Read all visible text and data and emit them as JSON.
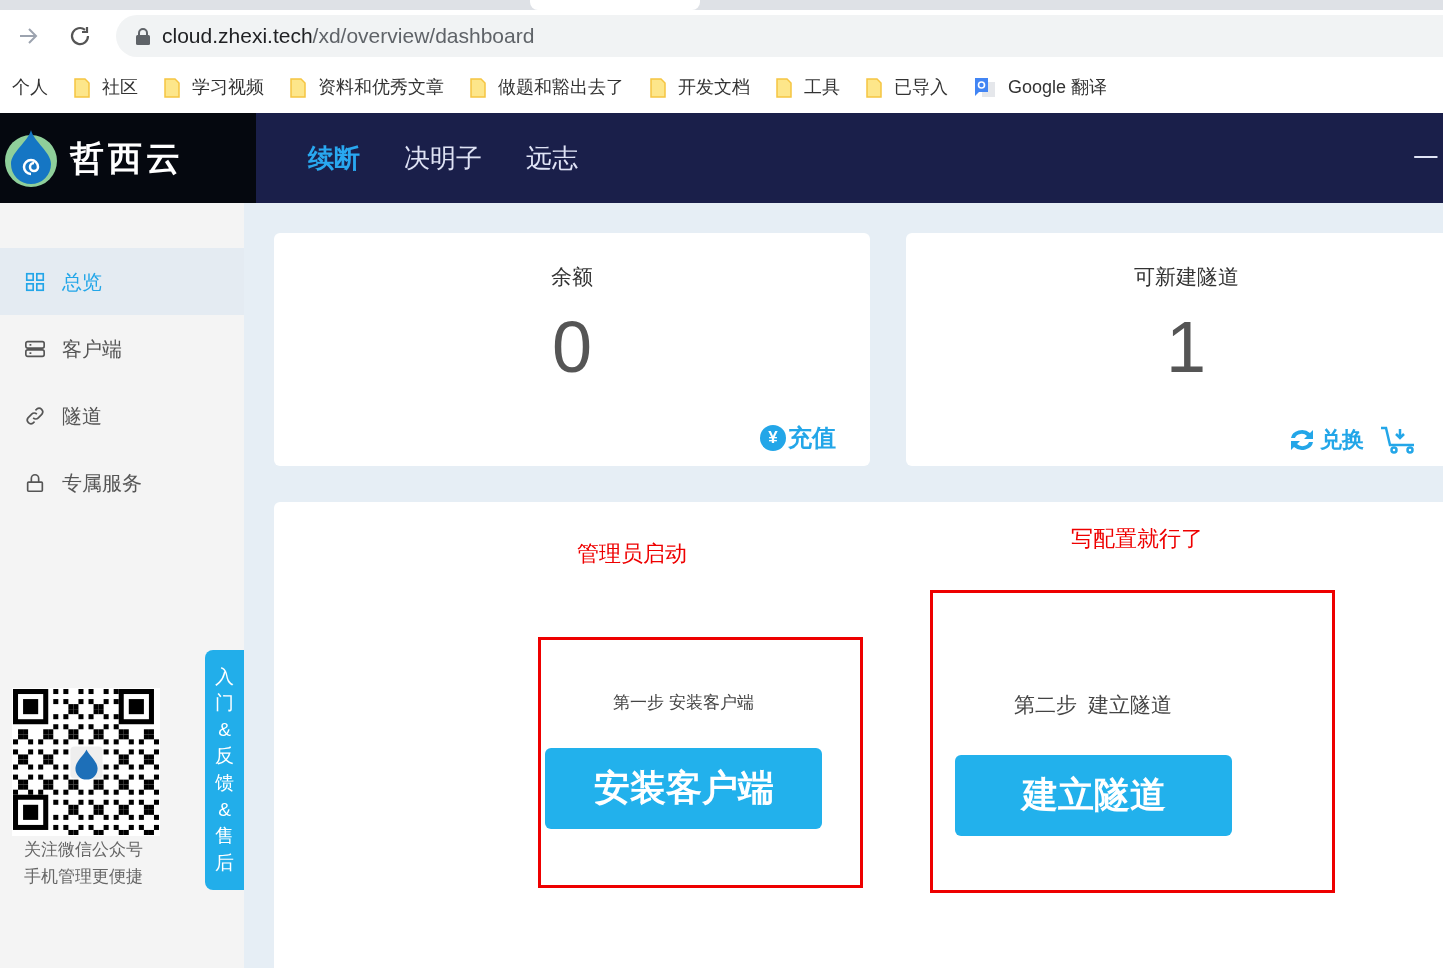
{
  "browser": {
    "url_host": "cloud.zhexi.tech",
    "url_path": "/xd/overview/dashboard",
    "bookmarks": [
      {
        "label": "个人",
        "kind": "text"
      },
      {
        "label": "社区",
        "kind": "folder"
      },
      {
        "label": "学习视频",
        "kind": "folder"
      },
      {
        "label": "资料和优秀文章",
        "kind": "folder"
      },
      {
        "label": "做题和豁出去了",
        "kind": "folder"
      },
      {
        "label": "开发文档",
        "kind": "folder"
      },
      {
        "label": "工具",
        "kind": "folder"
      },
      {
        "label": "已导入",
        "kind": "folder"
      },
      {
        "label": "Google 翻译",
        "kind": "translate"
      }
    ]
  },
  "header": {
    "logo_text": "哲西云",
    "nav": [
      {
        "label": "续断",
        "selected": true
      },
      {
        "label": "决明子",
        "selected": false
      },
      {
        "label": "远志",
        "selected": false
      }
    ],
    "right_text": "一"
  },
  "sidebar": {
    "items": [
      {
        "label": "总览",
        "kind": "grid",
        "selected": true
      },
      {
        "label": "客户端",
        "kind": "server",
        "selected": false
      },
      {
        "label": "隧道",
        "kind": "link",
        "selected": false
      },
      {
        "label": "专属服务",
        "kind": "lock",
        "selected": false
      }
    ],
    "qr_caption": [
      "关注微信公众号",
      "手机管理更便捷"
    ],
    "feedback_tab": "入门&反馈&售后"
  },
  "cards": [
    {
      "title": "余额",
      "value": "0",
      "actions": [
        {
          "kind": "yen",
          "glyph": "¥",
          "label": "充值"
        }
      ]
    },
    {
      "title": "可新建隧道",
      "value": "1",
      "actions": [
        {
          "kind": "exchange",
          "label": "兑换"
        },
        {
          "kind": "cart"
        }
      ]
    }
  ],
  "steps": {
    "annotations": [
      "管理员启动",
      "写配置就行了"
    ],
    "items": [
      {
        "caption": "第一步 安装客户端",
        "button": "安装客户端"
      },
      {
        "caption": "第二步  建立隧道",
        "button": "建立隧道"
      }
    ]
  }
}
